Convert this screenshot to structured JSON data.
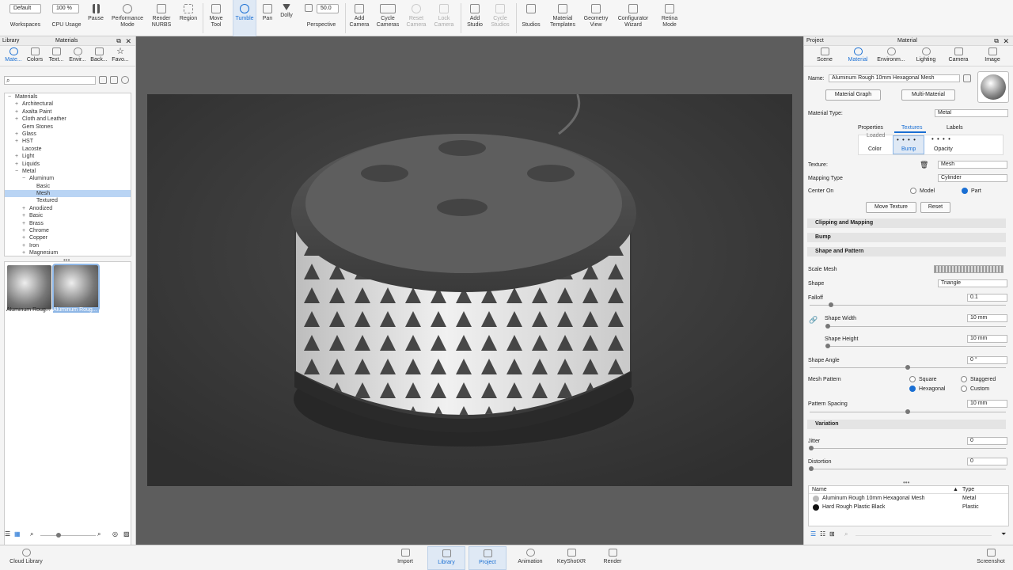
{
  "toolbar": {
    "workspace_value": "Default",
    "workspaces": "Workspaces",
    "cpu_value": "100 %",
    "cpu_usage": "CPU Usage",
    "pause": "Pause",
    "performance_mode": "Performance Mode",
    "render_nurbs": "Render NURBS",
    "region": "Region",
    "move_tool": "Move Tool",
    "tumble": "Tumble",
    "pan": "Pan",
    "dolly": "Dolly",
    "fov_value": "50.0",
    "perspective": "Perspective",
    "add_camera": "Add Camera",
    "cycle_cameras": "Cycle Cameras",
    "reset_camera": "Reset Camera",
    "lock_camera": "Lock Camera",
    "add_studio": "Add Studio",
    "cycle_studios": "Cycle Studios",
    "studios": "Studios",
    "material_templates": "Material Templates",
    "geometry_view": "Geometry View",
    "configurator_wizard": "Configurator Wizard",
    "retina_mode": "Retina Mode"
  },
  "library": {
    "title": "Library",
    "center_title": "Materials",
    "tabs": [
      "Mate...",
      "Colors",
      "Text...",
      "Envir...",
      "Back...",
      "Favo..."
    ],
    "tree": [
      {
        "label": "Materials",
        "indent": 0,
        "toggle": "−"
      },
      {
        "label": "Architectural",
        "indent": 1,
        "toggle": "+"
      },
      {
        "label": "Axalta Paint",
        "indent": 1,
        "toggle": "+"
      },
      {
        "label": "Cloth and Leather",
        "indent": 1,
        "toggle": "+"
      },
      {
        "label": "Gem Stones",
        "indent": 1,
        "toggle": ""
      },
      {
        "label": "Glass",
        "indent": 1,
        "toggle": "+"
      },
      {
        "label": "HST",
        "indent": 1,
        "toggle": "+"
      },
      {
        "label": "Lacoste",
        "indent": 1,
        "toggle": ""
      },
      {
        "label": "Light",
        "indent": 1,
        "toggle": "+"
      },
      {
        "label": "Liquids",
        "indent": 1,
        "toggle": "+"
      },
      {
        "label": "Metal",
        "indent": 1,
        "toggle": "−"
      },
      {
        "label": "Aluminum",
        "indent": 2,
        "toggle": "−"
      },
      {
        "label": "Basic",
        "indent": 3,
        "toggle": ""
      },
      {
        "label": "Mesh",
        "indent": 3,
        "toggle": "",
        "selected": true
      },
      {
        "label": "Textured",
        "indent": 3,
        "toggle": ""
      },
      {
        "label": "Anodized",
        "indent": 2,
        "toggle": "+"
      },
      {
        "label": "Basic",
        "indent": 2,
        "toggle": "+"
      },
      {
        "label": "Brass",
        "indent": 2,
        "toggle": "+"
      },
      {
        "label": "Chrome",
        "indent": 2,
        "toggle": "+"
      },
      {
        "label": "Copper",
        "indent": 2,
        "toggle": "+"
      },
      {
        "label": "Iron",
        "indent": 2,
        "toggle": "+"
      },
      {
        "label": "Magnesium",
        "indent": 2,
        "toggle": "+"
      }
    ],
    "thumbnails": [
      "Aluminum Roug...",
      "Aluminum Roug..."
    ]
  },
  "project": {
    "title": "Project",
    "center_title": "Material",
    "tabs": [
      "Scene",
      "Material",
      "Environm...",
      "Lighting",
      "Camera",
      "Image"
    ],
    "name_label": "Name:",
    "name_value": "Aluminum Rough 10mm Hexagonal Mesh",
    "material_graph": "Material Graph",
    "multi_material": "Multi-Material",
    "material_type_label": "Material Type:",
    "material_type_value": "Metal",
    "subtabs": [
      "Properties",
      "Textures",
      "Labels"
    ],
    "texture_slots": [
      "Color",
      "Bump",
      "Opacity"
    ],
    "slot_partial": "Loaded",
    "texture_label": "Texture:",
    "texture_value": "Mesh",
    "mapping_type_label": "Mapping Type",
    "mapping_type_value": "Cylinder",
    "center_on_label": "Center On",
    "center_model": "Model",
    "center_part": "Part",
    "move_texture": "Move Texture",
    "reset": "Reset",
    "sections": [
      "Clipping and Mapping",
      "Bump",
      "Shape and Pattern",
      "Variation"
    ],
    "scale_mesh": "Scale Mesh",
    "shape_label": "Shape",
    "shape_value": "Triangle",
    "falloff_label": "Falloff",
    "falloff_value": "0.1",
    "shape_width_label": "Shape Width",
    "shape_width_value": "10 mm",
    "shape_height_label": "Shape Height",
    "shape_height_value": "10 mm",
    "shape_angle_label": "Shape Angle",
    "shape_angle_value": "0 °",
    "mesh_pattern_label": "Mesh Pattern",
    "pattern_square": "Square",
    "pattern_staggered": "Staggered",
    "pattern_hexagonal": "Hexagonal",
    "pattern_custom": "Custom",
    "pattern_spacing_label": "Pattern Spacing",
    "pattern_spacing_value": "10 mm",
    "jitter_label": "Jitter",
    "jitter_value": "0",
    "distortion_label": "Distortion",
    "distortion_value": "0",
    "list_headers": [
      "Name",
      "Type"
    ],
    "list_rows": [
      [
        "Aluminum Rough 10mm Hexagonal Mesh",
        "Metal"
      ],
      [
        "Hard Rough Plastic Black",
        "Plastic"
      ]
    ],
    "slider_levels": {
      "falloff": 0.1,
      "shape_width": 0.0,
      "shape_height": 0.0,
      "shape_angle": 0.5,
      "pattern_spacing": 0.5,
      "jitter": 0.0,
      "distortion": 0.0
    }
  },
  "bottom": {
    "cloud_library": "Cloud Library",
    "tabs": [
      "Import",
      "Library",
      "Project",
      "Animation",
      "KeyShotXR",
      "Render"
    ],
    "screenshot": "Screenshot"
  }
}
